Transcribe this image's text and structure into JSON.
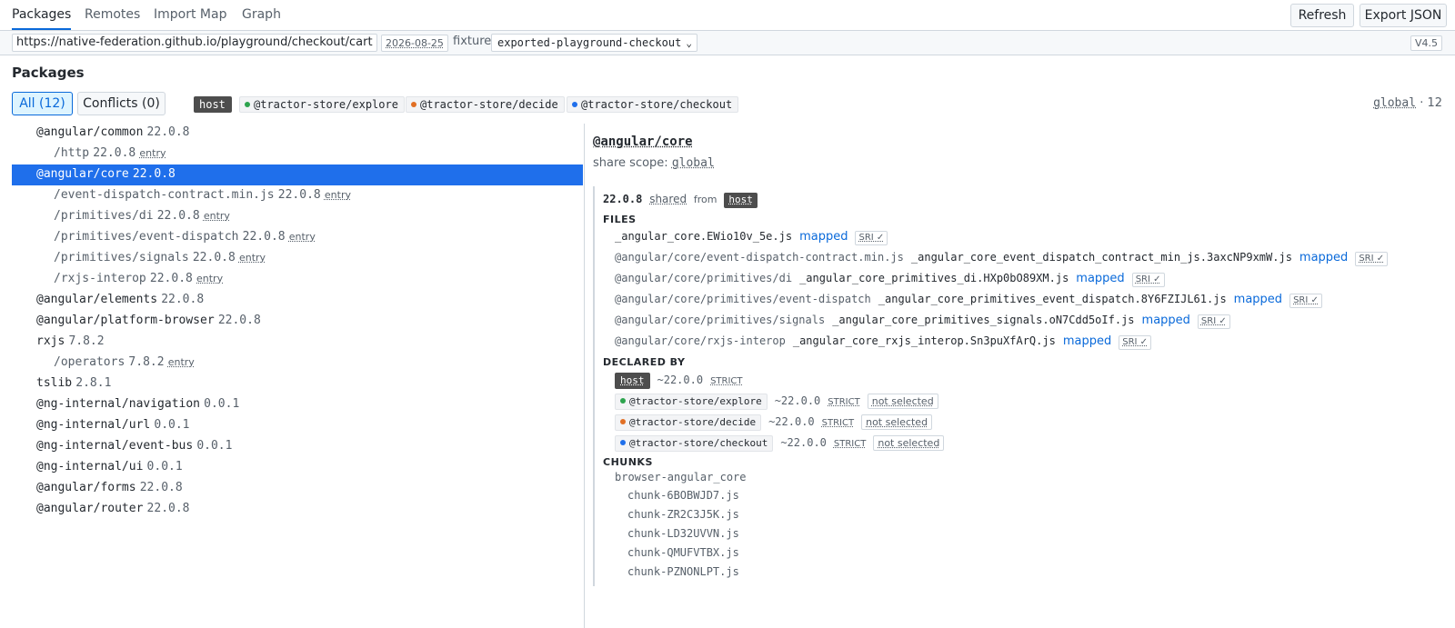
{
  "tabs": [
    {
      "label": "Packages",
      "active": true
    },
    {
      "label": "Remotes",
      "active": false
    },
    {
      "label": "Import Map",
      "active": false
    },
    {
      "label": "Graph",
      "active": false
    }
  ],
  "toolbar": {
    "refresh_label": "Refresh",
    "export_label": "Export JSON"
  },
  "address": {
    "url": "https://native-federation.github.io/playground/checkout/cart",
    "date": "2026-08-25",
    "fixture_label": "fixture",
    "fixture_value": "exported-playground-checkout",
    "version": "V4.5"
  },
  "heading": "Packages",
  "filters": {
    "all": "All (12)",
    "conflicts": "Conflicts (0)"
  },
  "remotes": [
    {
      "label": "host",
      "color": "#4d4d4d"
    },
    {
      "label": "@tractor-store/explore",
      "color": "#2da44e"
    },
    {
      "label": "@tractor-store/decide",
      "color": "#e16f24"
    },
    {
      "label": "@tractor-store/checkout",
      "color": "#1f6feb"
    }
  ],
  "scope_summary": {
    "scope": "global",
    "count": "· 12"
  },
  "tree": [
    {
      "name": "@angular/common",
      "version": "22.0.8",
      "entry": "",
      "level": 0,
      "selected": false
    },
    {
      "name": "/http",
      "version": "22.0.8",
      "entry": "entry",
      "level": 1,
      "selected": false
    },
    {
      "name": "@angular/core",
      "version": "22.0.8",
      "entry": "",
      "level": 0,
      "selected": true
    },
    {
      "name": "/event-dispatch-contract.min.js",
      "version": "22.0.8",
      "entry": "entry",
      "level": 1,
      "selected": false
    },
    {
      "name": "/primitives/di",
      "version": "22.0.8",
      "entry": "entry",
      "level": 1,
      "selected": false
    },
    {
      "name": "/primitives/event-dispatch",
      "version": "22.0.8",
      "entry": "entry",
      "level": 1,
      "selected": false
    },
    {
      "name": "/primitives/signals",
      "version": "22.0.8",
      "entry": "entry",
      "level": 1,
      "selected": false
    },
    {
      "name": "/rxjs-interop",
      "version": "22.0.8",
      "entry": "entry",
      "level": 1,
      "selected": false
    },
    {
      "name": "@angular/elements",
      "version": "22.0.8",
      "entry": "",
      "level": 0,
      "selected": false
    },
    {
      "name": "@angular/platform-browser",
      "version": "22.0.8",
      "entry": "",
      "level": 0,
      "selected": false
    },
    {
      "name": "rxjs",
      "version": "7.8.2",
      "entry": "",
      "level": 0,
      "selected": false
    },
    {
      "name": "/operators",
      "version": "7.8.2",
      "entry": "entry",
      "level": 1,
      "selected": false
    },
    {
      "name": "tslib",
      "version": "2.8.1",
      "entry": "",
      "level": 0,
      "selected": false
    },
    {
      "name": "@ng-internal/navigation",
      "version": "0.0.1",
      "entry": "",
      "level": 0,
      "selected": false
    },
    {
      "name": "@ng-internal/url",
      "version": "0.0.1",
      "entry": "",
      "level": 0,
      "selected": false
    },
    {
      "name": "@ng-internal/event-bus",
      "version": "0.0.1",
      "entry": "",
      "level": 0,
      "selected": false
    },
    {
      "name": "@ng-internal/ui",
      "version": "0.0.1",
      "entry": "",
      "level": 0,
      "selected": false
    },
    {
      "name": "@angular/forms",
      "version": "22.0.8",
      "entry": "",
      "level": 0,
      "selected": false
    },
    {
      "name": "@angular/router",
      "version": "22.0.8",
      "entry": "",
      "level": 0,
      "selected": false
    }
  ],
  "detail": {
    "title": "@angular/core",
    "scope_label": "share scope:",
    "scope_value": "global",
    "version": "22.0.8",
    "shared": "shared",
    "from": "from",
    "from_host": "host",
    "files_label": "FILES",
    "files": [
      {
        "spec": "",
        "file": "_angular_core.EWio10v_5e.js",
        "mapped": "mapped",
        "sri": "SRI ✓"
      },
      {
        "spec": "@angular/core/event-dispatch-contract.min.js",
        "file": "_angular_core_event_dispatch_contract_min_js.3axcNP9xmW.js",
        "mapped": "mapped",
        "sri": "SRI ✓"
      },
      {
        "spec": "@angular/core/primitives/di",
        "file": "_angular_core_primitives_di.HXp0bO89XM.js",
        "mapped": "mapped",
        "sri": "SRI ✓"
      },
      {
        "spec": "@angular/core/primitives/event-dispatch",
        "file": "_angular_core_primitives_event_dispatch.8Y6FZIJL61.js",
        "mapped": "mapped",
        "sri": "SRI ✓"
      },
      {
        "spec": "@angular/core/primitives/signals",
        "file": "_angular_core_primitives_signals.oN7Cdd5oIf.js",
        "mapped": "mapped",
        "sri": "SRI ✓"
      },
      {
        "spec": "@angular/core/rxjs-interop",
        "file": "_angular_core_rxjs_interop.Sn3puXfArQ.js",
        "mapped": "mapped",
        "sri": "SRI ✓"
      }
    ],
    "declared_label": "DECLARED BY",
    "declared": [
      {
        "remote": "host",
        "range": "~22.0.0",
        "strict": "STRICT",
        "status": "",
        "color": ""
      },
      {
        "remote": "@tractor-store/explore",
        "range": "~22.0.0",
        "strict": "STRICT",
        "status": "not selected",
        "color": "#2da44e"
      },
      {
        "remote": "@tractor-store/decide",
        "range": "~22.0.0",
        "strict": "STRICT",
        "status": "not selected",
        "color": "#e16f24"
      },
      {
        "remote": "@tractor-store/checkout",
        "range": "~22.0.0",
        "strict": "STRICT",
        "status": "not selected",
        "color": "#1f6feb"
      }
    ],
    "chunks_label": "CHUNKS",
    "chunk_group": "browser-angular_core",
    "chunks": [
      "chunk-6BOBWJD7.js",
      "chunk-ZR2C3J5K.js",
      "chunk-LD32UVVN.js",
      "chunk-QMUFVTBX.js",
      "chunk-PZNONLPT.js"
    ]
  }
}
